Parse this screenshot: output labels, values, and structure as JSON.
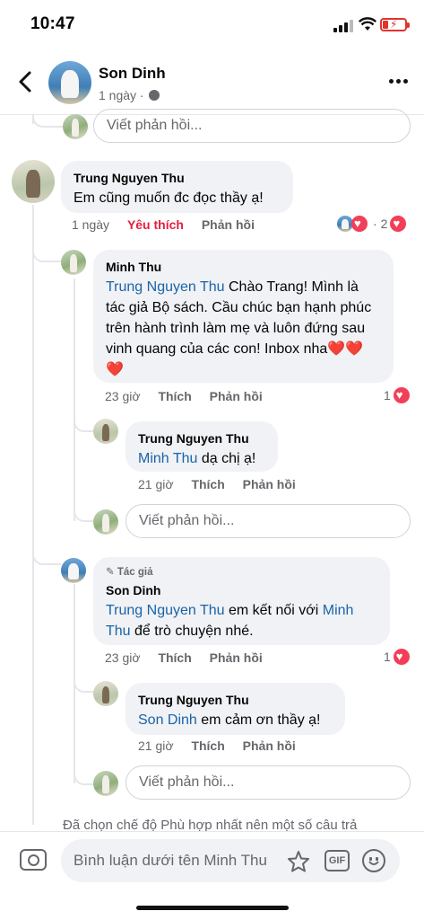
{
  "status": {
    "time": "10:47"
  },
  "header": {
    "name": "Son Dinh",
    "meta": "1 ngày ·"
  },
  "comments": {
    "top_reply_input": "Viết phản hồi...",
    "c1": {
      "author": "Trung Nguyen Thu",
      "text": "Em cũng muốn đc đọc thầy ạ!",
      "time": "1 ngày",
      "like": "Yêu thích",
      "reply": "Phản hồi",
      "react_count": "2"
    },
    "r1": {
      "author": "Minh Thu",
      "mention": "Trung Nguyen Thu",
      "text_lines": [
        "Chào Trang! Mình là",
        "tác giả Bộ sách. Cầu chúc bạn hạnh phúc",
        "trên hành trình làm mẹ và luôn đứng sau",
        "vinh quang của các con! Inbox nha❤️❤️",
        "❤️"
      ],
      "time": "23 giờ",
      "like": "Thích",
      "reply": "Phản hồi",
      "react_count": "1"
    },
    "r1a": {
      "author": "Trung Nguyen Thu",
      "mention": "Minh Thu",
      "text": "dạ chị ạ!",
      "time": "21 giờ",
      "like": "Thích",
      "reply": "Phản hồi"
    },
    "reply_input_1": "Viết phản hồi...",
    "r2": {
      "badge": "Tác giả",
      "author": "Son Dinh",
      "mention1": "Trung Nguyen Thu",
      "text1": " em kết nối với",
      "mention2a": "Minh",
      "mention2b": "Thu",
      "text2": "để trò chuyện nhé.",
      "time": "23 giờ",
      "like": "Thích",
      "reply": "Phản hồi",
      "react_count": "1"
    },
    "r2a": {
      "author": "Trung Nguyen Thu",
      "mention": "Son Dinh",
      "text": "em cảm ơn thầy ạ!",
      "time": "21 giờ",
      "like": "Thích",
      "reply": "Phản hồi"
    },
    "reply_input_2": "Viết phản hồi..."
  },
  "notice": "Đã chọn chế độ Phù hợp nhất nên một số câu trả",
  "composer": {
    "placeholder": "Bình luận dưới tên Minh Thu",
    "gif_label": "GIF"
  },
  "colors": {
    "mention": "#1b63a8",
    "love": "#e41e3f",
    "bubble": "#f0f2f5"
  }
}
